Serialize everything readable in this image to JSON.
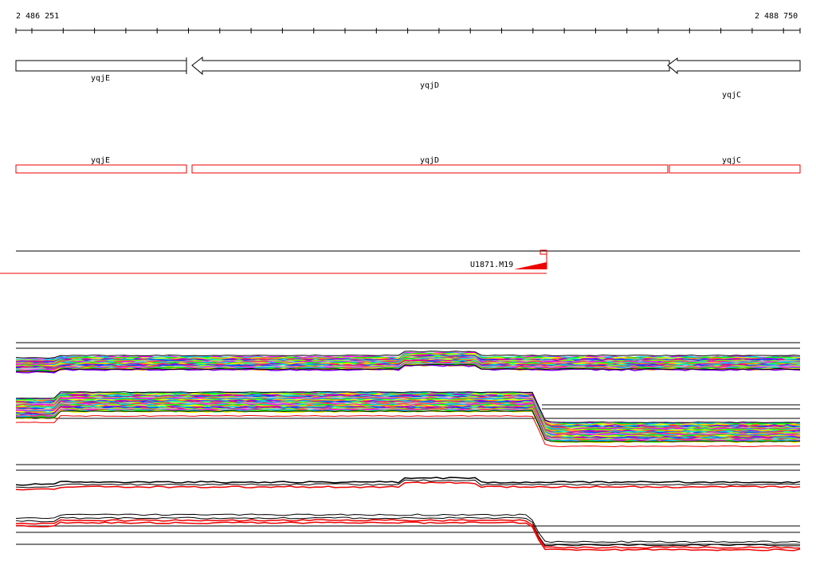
{
  "ruler": {
    "start": "2 486 251",
    "end": "2 488 750"
  },
  "genes": [
    {
      "name": "yqjE",
      "strand": "+"
    },
    {
      "name": "yqjD",
      "strand": "-"
    },
    {
      "name": "yqjC",
      "strand": "-"
    }
  ],
  "operon_labels": [
    "yqjE",
    "yqjD",
    "yqjC"
  ],
  "feature": {
    "label": "U1871.M19"
  },
  "colors": {
    "feature": "#ff0000",
    "axis": "#000000"
  }
}
